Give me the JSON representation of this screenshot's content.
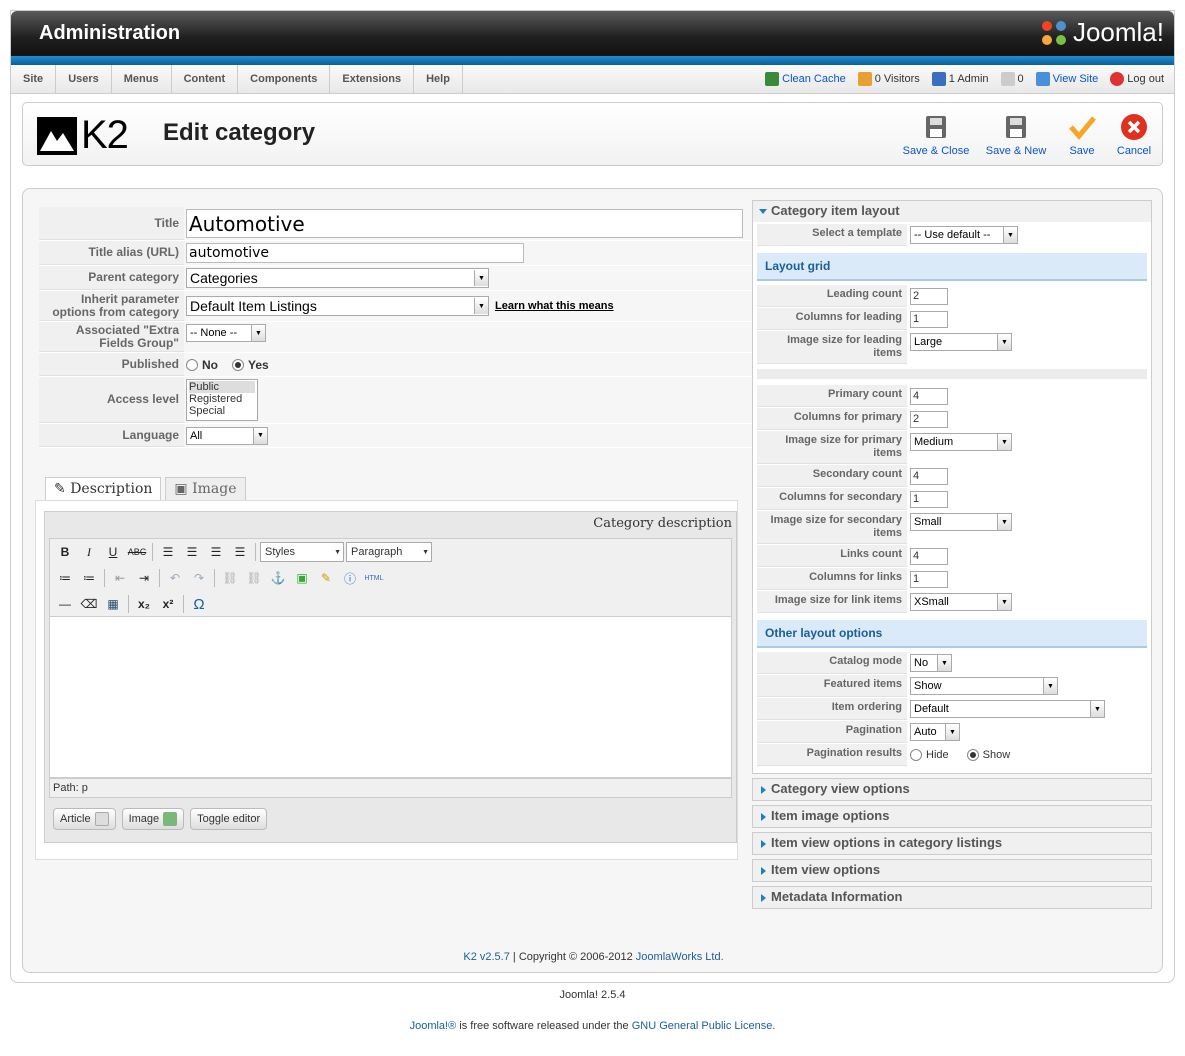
{
  "header": {
    "title": "Administration",
    "brand": "Joomla!"
  },
  "menu": [
    "Site",
    "Users",
    "Menus",
    "Content",
    "Components",
    "Extensions",
    "Help"
  ],
  "status": {
    "clean_cache": "Clean Cache",
    "visitors": "0 Visitors",
    "admins": "1 Admin",
    "messages": "0",
    "view_site": "View Site",
    "logout": "Log out"
  },
  "toolbar": {
    "logo": "K2",
    "page_title": "Edit category",
    "save_close": "Save & Close",
    "save_new": "Save & New",
    "save": "Save",
    "cancel": "Cancel"
  },
  "form": {
    "title_label": "Title",
    "title_value": "Automotive",
    "alias_label": "Title alias (URL)",
    "alias_value": "automotive",
    "parent_label": "Parent category",
    "parent_value": "Categories",
    "inherit_label": "Inherit parameter options from category",
    "inherit_value": "Default Item Listings",
    "inherit_link": "Learn what this means",
    "extra_label": "Associated \"Extra Fields Group\"",
    "extra_value": "-- None --",
    "published_label": "Published",
    "published_no": "No",
    "published_yes": "Yes",
    "access_label": "Access level",
    "access_options": [
      "Public",
      "Registered",
      "Special"
    ],
    "language_label": "Language",
    "language_value": "All"
  },
  "tabs": {
    "description": "Description",
    "image": "Image"
  },
  "editor": {
    "heading": "Category description",
    "styles": "Styles",
    "paragraph": "Paragraph",
    "path": "Path: p",
    "btn_article": "Article",
    "btn_image": "Image",
    "btn_toggle": "Toggle editor"
  },
  "right": {
    "layout_header": "Category item layout",
    "template_label": "Select a template",
    "template_value": "-- Use default --",
    "grid_header": "Layout grid",
    "leading_count_label": "Leading count",
    "leading_count": "2",
    "leading_cols_label": "Columns for leading",
    "leading_cols": "1",
    "leading_img_label": "Image size for leading items",
    "leading_img": "Large",
    "primary_count_label": "Primary count",
    "primary_count": "4",
    "primary_cols_label": "Columns for primary",
    "primary_cols": "2",
    "primary_img_label": "Image size for primary items",
    "primary_img": "Medium",
    "secondary_count_label": "Secondary count",
    "secondary_count": "4",
    "secondary_cols_label": "Columns for secondary",
    "secondary_cols": "1",
    "secondary_img_label": "Image size for secondary items",
    "secondary_img": "Small",
    "links_count_label": "Links count",
    "links_count": "4",
    "links_cols_label": "Columns for links",
    "links_cols": "1",
    "links_img_label": "Image size for link items",
    "links_img": "XSmall",
    "other_header": "Other layout options",
    "catalog_label": "Catalog mode",
    "catalog": "No",
    "featured_label": "Featured items",
    "featured": "Show",
    "ordering_label": "Item ordering",
    "ordering": "Default",
    "pagination_label": "Pagination",
    "pagination": "Auto",
    "pag_results_label": "Pagination results",
    "pag_hide": "Hide",
    "pag_show": "Show",
    "collapsed": [
      "Category view options",
      "Item image options",
      "Item view options in category listings",
      "Item view options",
      "Metadata Information"
    ]
  },
  "footer": {
    "k2_version": "K2 v2.5.7",
    "copyright": " | Copyright © 2006-2012 ",
    "company": "JoomlaWorks Ltd.",
    "joomla_version": "Joomla! 2.5.4",
    "joomla_link": "Joomla!®",
    "free_text": " is free software released under the ",
    "license": "GNU General Public License",
    "period": "."
  }
}
